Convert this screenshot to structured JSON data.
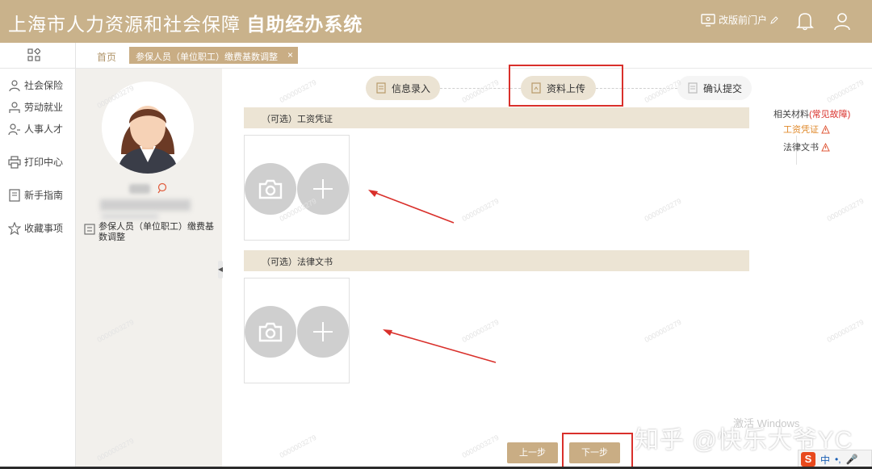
{
  "header": {
    "title_part1": "上海市人力资源和社会保障",
    "title_part2": "自助经办系统",
    "portal_label": "改版前门户",
    "icons": [
      "monitor-icon",
      "pencil-icon",
      "bell-icon",
      "user-icon"
    ]
  },
  "sidebar": {
    "items": [
      {
        "label": "社会保险",
        "icon": "social-insurance-icon"
      },
      {
        "label": "劳动就业",
        "icon": "employment-icon"
      },
      {
        "label": "人事人才",
        "icon": "talent-icon"
      },
      {
        "label": "打印中心",
        "icon": "printer-icon"
      },
      {
        "label": "新手指南",
        "icon": "guide-icon"
      },
      {
        "label": "收藏事项",
        "icon": "star-icon"
      }
    ]
  },
  "tabs": {
    "home": "首页",
    "active": "参保人员（单位职工）缴费基数调整",
    "close": "×"
  },
  "profile": {
    "service_name": "参保人员（单位职工）缴费基数调整"
  },
  "steps": [
    {
      "label": "信息录入",
      "state": "done"
    },
    {
      "label": "资料上传",
      "state": "current"
    },
    {
      "label": "确认提交",
      "state": "pending"
    }
  ],
  "sections": [
    {
      "title": "（可选）工资凭证"
    },
    {
      "title": "（可选）法律文书"
    }
  ],
  "related": {
    "label": "相关材料",
    "faq": "(常见故障)",
    "items": [
      {
        "label": "工资凭证",
        "active": true
      },
      {
        "label": "法律文书",
        "active": false
      }
    ]
  },
  "buttons": {
    "prev": "上一步",
    "next": "下一步"
  },
  "watermark_text": "0000003279",
  "overlay": {
    "zhihu": "知乎 @快乐大爷YC",
    "activate": "激活 Windows",
    "ime_logo": "S",
    "ime_lang": "中",
    "ime_punct": "•,",
    "ime_mic": "🎤"
  },
  "colors": {
    "brand": "#c9b28b",
    "accent": "#c9ad84",
    "annotation_red": "#d9302b"
  }
}
